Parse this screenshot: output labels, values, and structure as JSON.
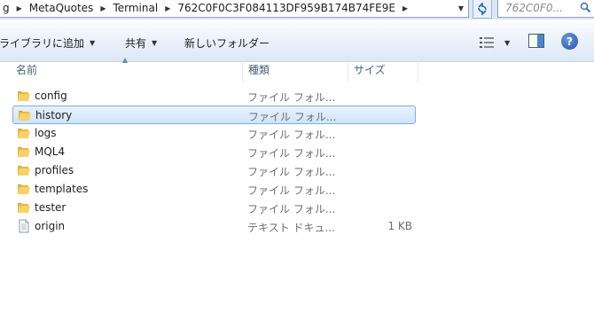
{
  "address": {
    "crumbs": [
      "g",
      "MetaQuotes",
      "Terminal",
      "762C0F0C3F084113DF959B174B74FE9E"
    ]
  },
  "search": {
    "placeholder": "762C0F0..."
  },
  "toolbar": {
    "add_to_library": "ライブラリに追加",
    "share": "共有",
    "new_folder": "新しいフォルダー",
    "help": "?"
  },
  "columns": {
    "name": "名前",
    "type": "種類",
    "size": "サイズ"
  },
  "files": [
    {
      "name": "config",
      "type": "ファイル フォル...",
      "size": "",
      "icon": "folder-icon",
      "selected": false
    },
    {
      "name": "history",
      "type": "ファイル フォル...",
      "size": "",
      "icon": "folder-icon",
      "selected": true
    },
    {
      "name": "logs",
      "type": "ファイル フォル...",
      "size": "",
      "icon": "folder-icon",
      "selected": false
    },
    {
      "name": "MQL4",
      "type": "ファイル フォル...",
      "size": "",
      "icon": "folder-icon",
      "selected": false
    },
    {
      "name": "profiles",
      "type": "ファイル フォル...",
      "size": "",
      "icon": "folder-icon",
      "selected": false
    },
    {
      "name": "templates",
      "type": "ファイル フォル...",
      "size": "",
      "icon": "folder-icon",
      "selected": false
    },
    {
      "name": "tester",
      "type": "ファイル フォル...",
      "size": "",
      "icon": "folder-icon",
      "selected": false
    },
    {
      "name": "origin",
      "type": "テキスト ドキュ...",
      "size": "1 KB",
      "icon": "text-file-icon",
      "selected": false
    }
  ],
  "colors": {
    "accent": "#2551a6",
    "selection_border": "#84acdd",
    "folder": "#e8b740"
  }
}
